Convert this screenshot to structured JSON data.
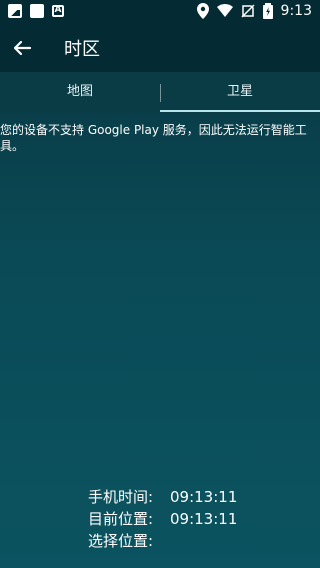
{
  "status_bar": {
    "time": "9:13",
    "left_icons": [
      "image-icon",
      "blank-square-icon",
      "a-icon"
    ],
    "right_icons": [
      "location-icon",
      "wifi-icon",
      "no-sim-icon",
      "battery-charging-icon"
    ]
  },
  "app_bar": {
    "title": "时区",
    "back_icon": "arrow-left-icon"
  },
  "tabs": [
    {
      "label": "地图",
      "selected": false
    },
    {
      "label": "卫星",
      "selected": true
    }
  ],
  "message": "您的设备不支持 Google Play 服务，因此无法运行智能工具。",
  "info": {
    "phone_time_label": "手机时间:",
    "phone_time_value": "09:13:11",
    "current_location_label": "目前位置:",
    "current_location_value": "09:13:11",
    "selected_location_label": "选择位置:",
    "selected_location_value": ""
  },
  "colors": {
    "statusbar_bg": "#042a33",
    "tabs_bg": "#0a3c46",
    "indicator": "#b8e6ef"
  }
}
